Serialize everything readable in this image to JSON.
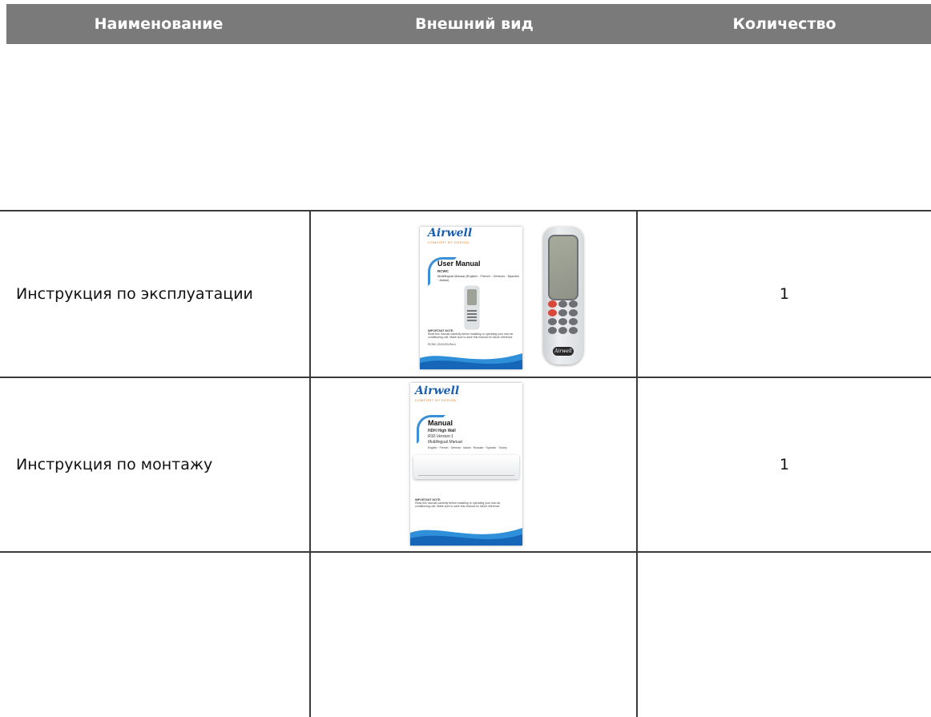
{
  "header": {
    "col1": "Наименование",
    "col2": "Внешний вид",
    "col3": "Количество"
  },
  "rows": [
    {
      "name": "Инструкция по эксплуатации",
      "quantity": "1",
      "image": {
        "brand": "Airwell",
        "tagline": "COMFORT BY DESIGN",
        "title": "User Manual",
        "subtitle": "RCWC",
        "subtitle2": "Multilingual Manual (English · French · German · Spanish · Italian)",
        "note_title": "IMPORTANT NOTE:",
        "note_text": "Read this manual carefully before installing or operating your new air conditioning unit. Make sure to save this manual for future reference.",
        "code": "RCWC-2019-EN-Rev1",
        "remote_badge": "Airwell"
      }
    },
    {
      "name": "Инструкция по монтажу",
      "quantity": "1",
      "image": {
        "brand": "Airwell",
        "tagline": "COMFORT BY DESIGN",
        "title": "Manual",
        "subtitle": "HDH High Wall",
        "subtitle2": "R32-Version:1",
        "subtitle3": "Multilingual Manual",
        "langs": "English · French · German · Italian · Russian · Spanish · Turkey",
        "note_title": "IMPORTANT NOTE:",
        "note_text": "Read this manual carefully before installing or operating your new air conditioning unit. Make sure to save this manual for future reference."
      }
    }
  ],
  "colors": {
    "header_bg": "#7a7a7a",
    "brand_blue": "#1a5fb0",
    "wave_blue": "#2f8fd8",
    "accent_orange": "#e07b1a",
    "rule": "#3a3a3a"
  }
}
